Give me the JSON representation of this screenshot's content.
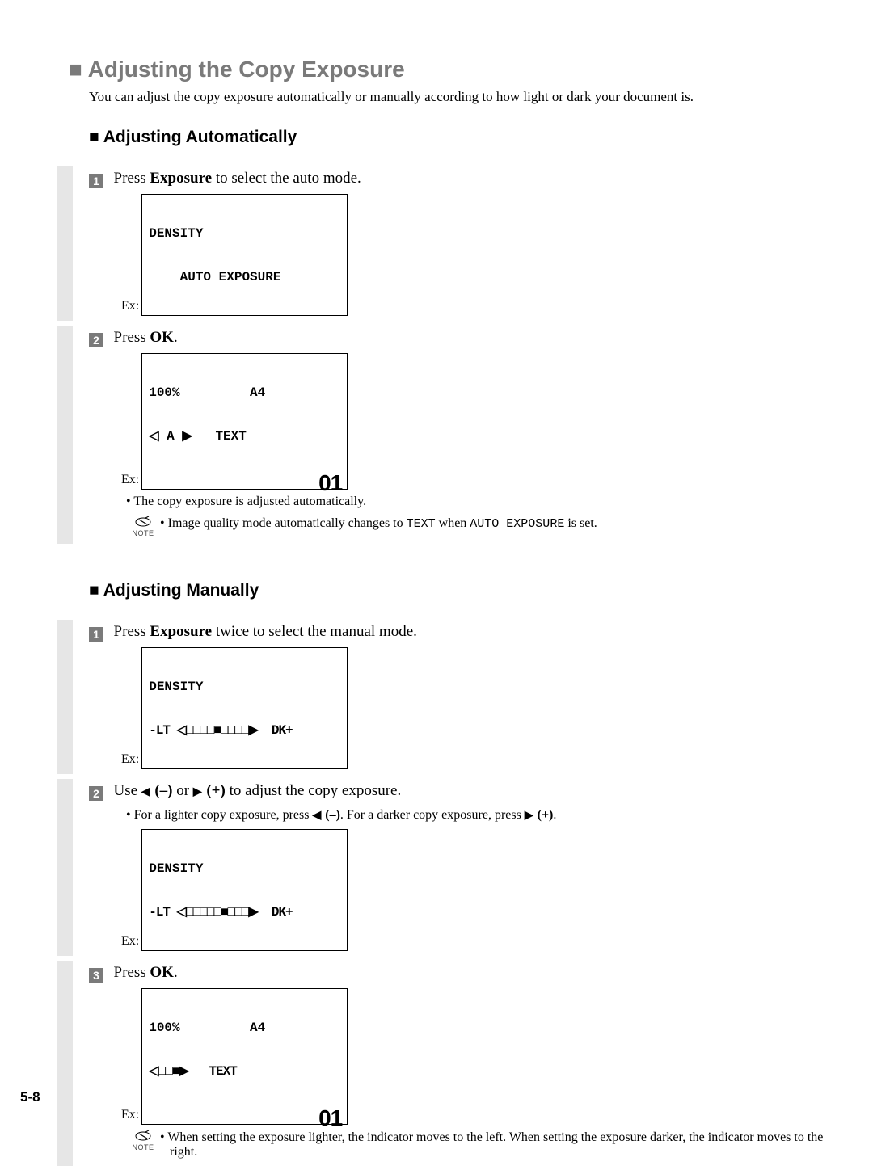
{
  "h1": "Adjusting the Copy Exposure",
  "intro": "You can adjust the copy exposure automatically or manually according to how light or dark your document is.",
  "auto": {
    "heading": "Adjusting Automatically",
    "step1": {
      "pre": "Press ",
      "bold": "Exposure",
      "post": " to select the auto mode.",
      "ex_label": "Ex:",
      "lcd_line1": "DENSITY",
      "lcd_line2": "    AUTO EXPOSURE"
    },
    "step2": {
      "pre": "Press ",
      "bold": "OK",
      "post": ".",
      "ex_label": "Ex:",
      "lcd_line1": "100%         A4",
      "lcd_line2": "◁ A ▶   TEXT",
      "big": "01",
      "bullet": "The copy exposure is adjusted automatically.",
      "note_pre": "Image quality mode automatically changes to ",
      "note_mono1": "TEXT",
      "note_mid": " when ",
      "note_mono2": "AUTO EXPOSURE",
      "note_post": " is set.",
      "note_label": "NOTE"
    }
  },
  "manual": {
    "heading": "Adjusting Manually",
    "step1": {
      "pre": "Press ",
      "bold": "Exposure",
      "post": " twice to select the manual mode.",
      "ex_label": "Ex:",
      "lcd_line1": "DENSITY",
      "lcd_line2": "-LT ◁□□□□■□□□□▶  DK+"
    },
    "step2": {
      "text_pre": "Use ",
      "minus": " (–)",
      "or": " or ",
      "plus": " (+)",
      "text_post": " to adjust the copy exposure.",
      "bullet_pre": "For a lighter copy exposure, press ",
      "bullet_minus": " (–)",
      "bullet_mid": ". For a darker copy exposure, press ",
      "bullet_plus": " (+)",
      "bullet_post": ".",
      "ex_label": "Ex:",
      "lcd_line1": "DENSITY",
      "lcd_line2": "-LT ◁□□□□□■□□□▶  DK+"
    },
    "step3": {
      "pre": "Press ",
      "bold": "OK",
      "post": ".",
      "ex_label": "Ex:",
      "lcd_line1": "100%         A4",
      "lcd_line2": "◁□□■▶   TEXT",
      "big": "01",
      "note": "When setting the exposure lighter, the indicator moves to the left. When setting the exposure darker, the indicator moves to the right.",
      "note_label": "NOTE"
    }
  },
  "page_num": "5-8"
}
